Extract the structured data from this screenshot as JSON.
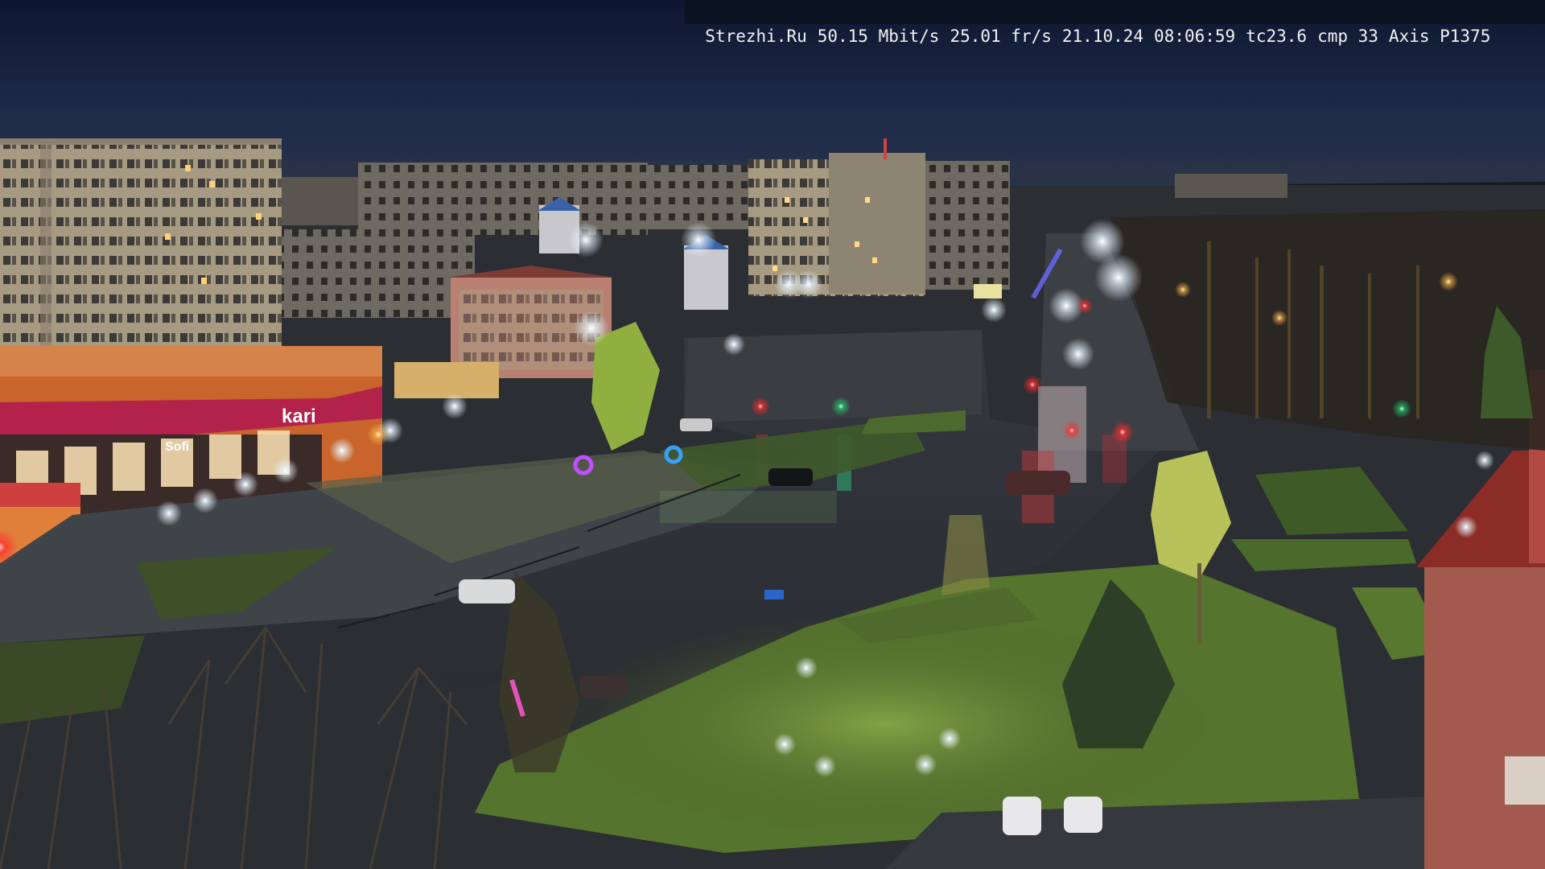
{
  "overlay": {
    "site": "Strezhi.Ru",
    "bitrate": "50.15 Mbit/s",
    "framerate": "25.01 fr/s",
    "date": "21.10.24",
    "time": "08:06:59",
    "tc": "tc23.6",
    "cmp": "cmp 33",
    "camera": "Axis P1375"
  },
  "signs": {
    "store_name": "kari",
    "store_small": "Sofi"
  },
  "colors": {
    "sky": "#1a2744",
    "road_wet": "#3a3e44",
    "grass_lit": "#6f8f3a",
    "building_panel": "#b9ab92",
    "store_orange": "#d46a2a"
  }
}
